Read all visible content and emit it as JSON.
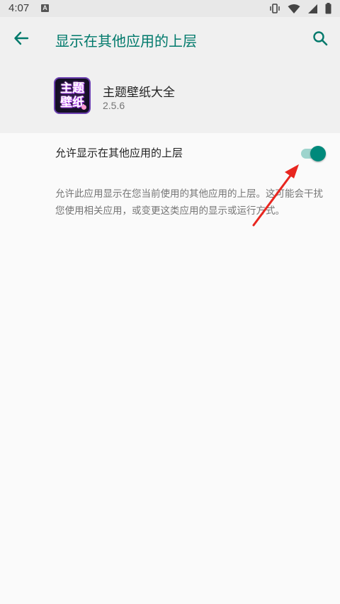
{
  "status_bar": {
    "time": "4:07",
    "notification_glyph": "A",
    "icons": [
      "vibrate-icon",
      "wifi-icon",
      "signal-icon",
      "battery-icon"
    ]
  },
  "app_bar": {
    "title": "显示在其他应用的上层",
    "back_icon": "arrow-left-icon",
    "search_icon": "search-icon",
    "accent_color": "#00796b"
  },
  "app_info": {
    "icon_text_line1": "主题",
    "icon_text_line2": "壁纸",
    "name": "主题壁纸大全",
    "version": "2.5.6"
  },
  "permission": {
    "label": "允许显示在其他应用的上层",
    "enabled": true,
    "switch_color": "#00897b",
    "summary": "允许此应用显示在您当前使用的其他应用的上层。这可能会干扰您使用相关应用，或变更这类应用的显示或运行方式。"
  },
  "annotation": {
    "arrow_color": "#e8261f"
  }
}
